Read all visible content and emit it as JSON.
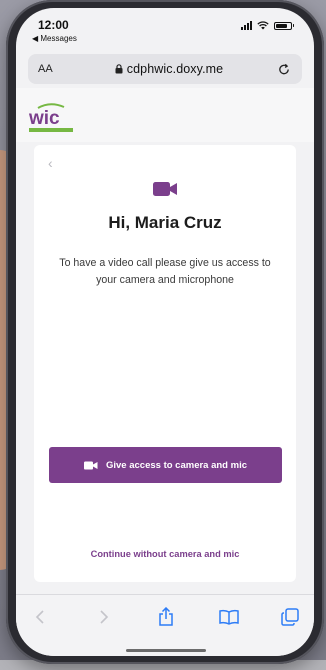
{
  "status_bar": {
    "time": "12:00",
    "back_app": "◀ Messages",
    "battery_level": 0.8
  },
  "browser": {
    "text_size_label": "AA",
    "url": "cdphwic.doxy.me"
  },
  "logo": {
    "text": "wic",
    "colors": {
      "purple": "#7b3f8c",
      "green": "#76b843"
    }
  },
  "card": {
    "greeting": "Hi, Maria Cruz",
    "description": "To have a video call please give us access to your camera and microphone",
    "primary_button": "Give access to camera and mic",
    "secondary_link": "Continue without camera and mic"
  },
  "toolbar": {
    "items": [
      "back-icon",
      "forward-icon",
      "share-icon",
      "bookmarks-icon",
      "tabs-icon"
    ],
    "accent": "#2d7cf6"
  },
  "theme": {
    "brand": "#7b3f8c"
  }
}
